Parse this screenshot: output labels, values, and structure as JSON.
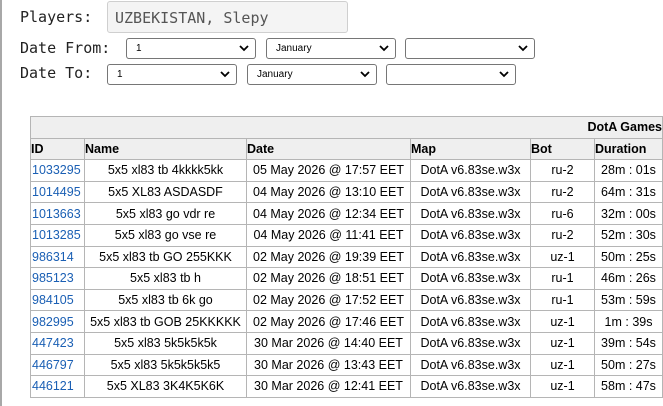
{
  "filters": {
    "players_label": "Players:",
    "players_value": "UZBEKISTAN, Slepy",
    "date_from_label": "Date From:",
    "date_to_label": "Date To:",
    "date_from": {
      "day": "1",
      "month": "January",
      "year": ""
    },
    "date_to": {
      "day": "1",
      "month": "January",
      "year": ""
    }
  },
  "table": {
    "caption": "DotA Games",
    "columns": [
      "ID",
      "Name",
      "Date",
      "Map",
      "Bot",
      "Duration"
    ],
    "rows": [
      [
        "1033295",
        "5x5 xl83 tb 4kkkk5kk",
        "05 May 2026 @ 17:57 EET",
        "DotA v6.83se.w3x",
        "ru-2",
        "28m : 01s"
      ],
      [
        "1014495",
        "5x5 XL83 ASDASDF",
        "04 May 2026 @ 13:10 EET",
        "DotA v6.83se.w3x",
        "ru-2",
        "64m : 31s"
      ],
      [
        "1013663",
        "5x5 xl83 go vdr re",
        "04 May 2026 @ 12:34 EET",
        "DotA v6.83se.w3x",
        "ru-6",
        "32m : 00s"
      ],
      [
        "1013285",
        "5x5 xl83 go vse re",
        "04 May 2026 @ 11:41 EET",
        "DotA v6.83se.w3x",
        "ru-2",
        "52m : 30s"
      ],
      [
        "986314",
        "5x5 xl83 tb GO 255KKK",
        "02 May 2026 @ 19:39 EET",
        "DotA v6.83se.w3x",
        "uz-1",
        "50m : 25s"
      ],
      [
        "985123",
        "5x5 xl83 tb h",
        "02 May 2026 @ 18:51 EET",
        "DotA v6.83se.w3x",
        "ru-1",
        "46m : 26s"
      ],
      [
        "984105",
        "5x5 xl83 tb 6k go",
        "02 May 2026 @ 17:52 EET",
        "DotA v6.83se.w3x",
        "ru-1",
        "53m : 59s"
      ],
      [
        "982995",
        "5x5 xl83 tb GOB 25KKKKK",
        "02 May 2026 @ 17:46 EET",
        "DotA v6.83se.w3x",
        "uz-1",
        "1m : 39s"
      ],
      [
        "447423",
        "5x5 xl83 5k5k5k5k",
        "30 Mar 2026 @ 14:40 EET",
        "DotA v6.83se.w3x",
        "uz-1",
        "39m : 54s"
      ],
      [
        "446797",
        "5x5 xl83 5k5k5k5k5",
        "30 Mar 2026 @ 13:43 EET",
        "DotA v6.83se.w3x",
        "uz-1",
        "50m : 27s"
      ],
      [
        "446121",
        "5x5 XL83 3K4K5K6K",
        "30 Mar 2026 @ 12:41 EET",
        "DotA v6.83se.w3x",
        "uz-1",
        "58m : 47s"
      ]
    ]
  },
  "colors": {
    "link": "#1a5fb4",
    "header_bg": "#efefef"
  }
}
